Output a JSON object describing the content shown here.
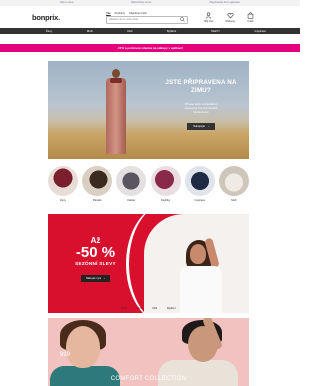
{
  "topbar": {
    "left": "Náš e-shop",
    "center": "Zákaznický servis",
    "right": "Objednávka bez registrace"
  },
  "header": {
    "logo_text": "bonprix",
    "search_tabs": [
      "Vše",
      "Produkty",
      "Objednací číslo"
    ],
    "search_placeholder": "Hledané slovo nebo číslo",
    "icons": [
      {
        "icon": "user-icon",
        "label": "Můj účet"
      },
      {
        "icon": "heart-icon",
        "label": "Oblíbené"
      },
      {
        "icon": "bag-icon",
        "label": "Košík"
      }
    ]
  },
  "nav": {
    "categories": [
      "Ženy",
      "Muži",
      "Děti",
      "Bydlení",
      "SLEVY",
      "Inspirace"
    ]
  },
  "promo": {
    "text": "-15% a poštovné zdarma na nákupy v aplikaci!"
  },
  "hero": {
    "title_line1": "JSTE PŘIPRAVENA NA",
    "title_line2": "ZIMU?",
    "subtitle_line1": "Přinese teplo a inspirativní",
    "subtitle_line2": "barevnost zimních šatníků",
    "subtitle_line3": "Moda Home",
    "button_label": "Nakupujte",
    "button_icon": "chevron-right-icon"
  },
  "categories": [
    {
      "label": "Ženy",
      "color1": "#7b1e2d",
      "color2": "#e8ddd6"
    },
    {
      "label": "Pánské",
      "color1": "#3b2a20",
      "color2": "#d9cfc3"
    },
    {
      "label": "Kabáty",
      "color1": "#5a5560",
      "color2": "#e4e0e2"
    },
    {
      "label": "Doplňky",
      "color1": "#8a2a4a",
      "color2": "#e9dde1"
    },
    {
      "label": "Inspirace",
      "color1": "#1f2b44",
      "color2": "#dfe3ea"
    },
    {
      "label": "Muži",
      "color1": "#efeae4",
      "color2": "#cfc6bb"
    }
  ],
  "sale": {
    "prefix": "Až",
    "percent": "-50 %",
    "label": "SEZÓNNÍ SLEVY",
    "button_label": "Nakupte nyní",
    "sub_categories": [
      "Ženy",
      "Muži",
      "Děti",
      "Bydlení"
    ]
  },
  "comfort": {
    "price": "999",
    "title": "COMFORT COLLECTION"
  },
  "colors": {
    "accent": "#e4007d",
    "sale_red": "#d8102d",
    "nav_bg": "#333333"
  }
}
